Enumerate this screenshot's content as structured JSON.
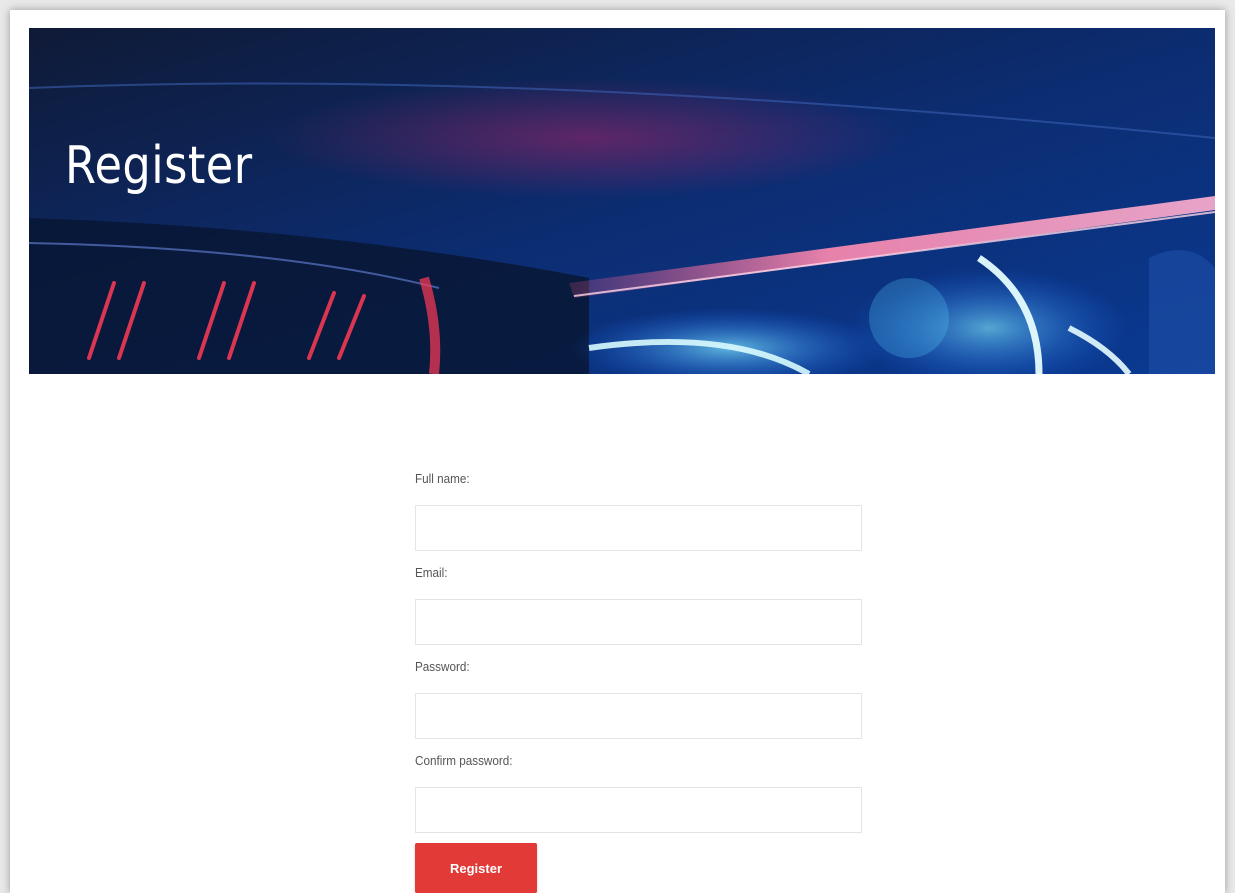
{
  "hero": {
    "title": "Register"
  },
  "form": {
    "fields": [
      {
        "label": "Full name:",
        "value": "",
        "placeholder": ""
      },
      {
        "label": "Email:",
        "value": "",
        "placeholder": ""
      },
      {
        "label": "Password:",
        "value": "",
        "placeholder": ""
      },
      {
        "label": "Confirm password:",
        "value": "",
        "placeholder": ""
      }
    ],
    "submit_label": "Register"
  },
  "colors": {
    "accent": "#e23a36",
    "hero_dark": "#0e1c3f",
    "hero_blue": "#0b3a8a"
  }
}
